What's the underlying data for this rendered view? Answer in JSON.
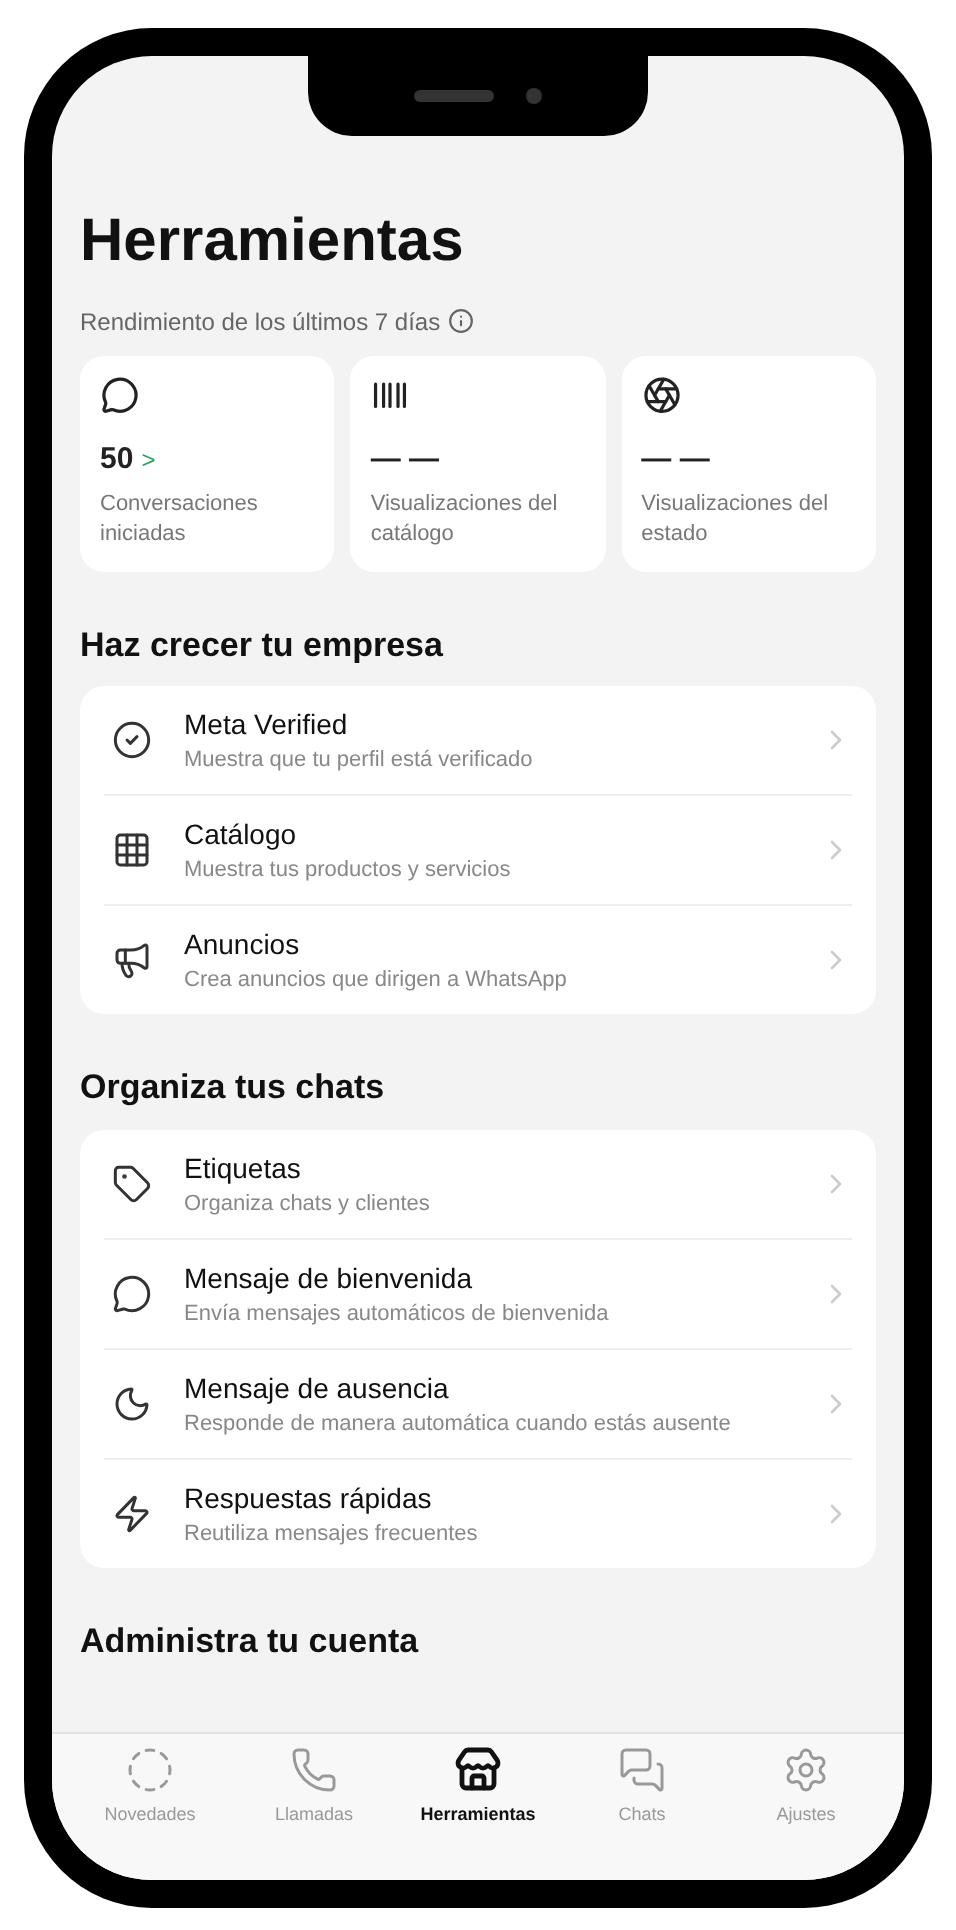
{
  "title": "Herramientas",
  "performance": {
    "label": "Rendimiento de los últimos 7 días",
    "stats": [
      {
        "kind": "chat",
        "value": "50",
        "arrow": ">",
        "label": "Conversaciones iniciadas"
      },
      {
        "kind": "catalog",
        "value": "— —",
        "label": "Visualizaciones del catálogo"
      },
      {
        "kind": "status",
        "value": "— —",
        "label": "Visualizaciones del estado"
      }
    ]
  },
  "sections": [
    {
      "title": "Haz crecer tu empresa",
      "items": [
        {
          "kind": "verified",
          "title": "Meta Verified",
          "subtitle": "Muestra que tu perfil está verificado"
        },
        {
          "kind": "catalog",
          "title": "Catálogo",
          "subtitle": "Muestra tus productos y servicios"
        },
        {
          "kind": "ads",
          "title": "Anuncios",
          "subtitle": "Crea anuncios que dirigen a WhatsApp"
        }
      ]
    },
    {
      "title": "Organiza tus chats",
      "items": [
        {
          "kind": "label",
          "title": "Etiquetas",
          "subtitle": "Organiza chats y clientes"
        },
        {
          "kind": "welcome",
          "title": "Mensaje de bienvenida",
          "subtitle": "Envía mensajes automáticos de bienvenida"
        },
        {
          "kind": "away",
          "title": "Mensaje de ausencia",
          "subtitle": "Responde de manera automática cuando estás ausente"
        },
        {
          "kind": "quick",
          "title": "Respuestas rápidas",
          "subtitle": "Reutiliza mensajes frecuentes"
        }
      ]
    },
    {
      "title": "Administra tu cuenta"
    }
  ],
  "tabs": [
    {
      "kind": "updates",
      "label": "Novedades",
      "selected": false
    },
    {
      "kind": "calls",
      "label": "Llamadas",
      "selected": false
    },
    {
      "kind": "tools",
      "label": "Herramientas",
      "selected": true
    },
    {
      "kind": "chats",
      "label": "Chats",
      "selected": false
    },
    {
      "kind": "settings",
      "label": "Ajustes",
      "selected": false
    }
  ]
}
